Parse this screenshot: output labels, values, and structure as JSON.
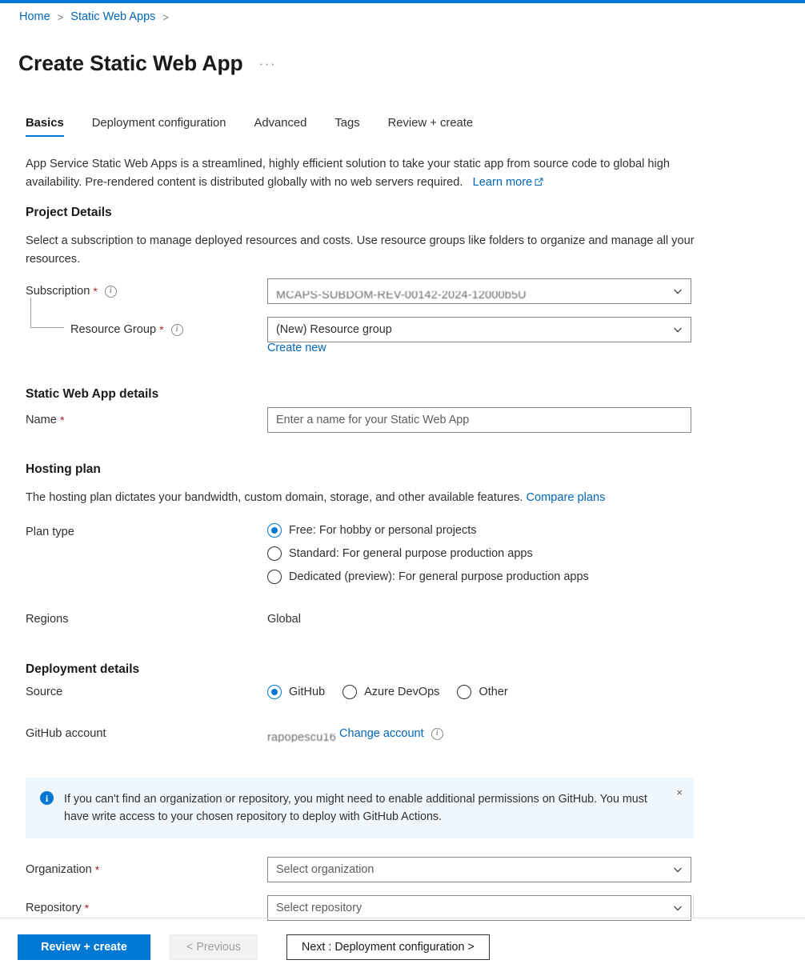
{
  "accent": "#0078d4",
  "link_color": "#0066bb",
  "required_color": "#a4262c",
  "breadcrumb": {
    "items": [
      {
        "label": "Home",
        "sep": ">"
      },
      {
        "label": "Static Web Apps",
        "sep": ">"
      }
    ]
  },
  "header": {
    "title": "Create Static Web App",
    "more_menu": "···"
  },
  "tabs": [
    {
      "label": "Basics",
      "active": true
    },
    {
      "label": "Deployment configuration",
      "active": false
    },
    {
      "label": "Advanced",
      "active": false
    },
    {
      "label": "Tags",
      "active": false
    },
    {
      "label": "Review + create",
      "active": false
    }
  ],
  "intro": {
    "text": "App Service Static Web Apps is a streamlined, highly efficient solution to take your static app from source code to global high availability. Pre-rendered content is distributed globally with no web servers required.",
    "learn_more": "Learn more"
  },
  "project_details": {
    "heading": "Project Details",
    "description": "Select a subscription to manage deployed resources and costs. Use resource groups like folders to organize and manage all your resources.",
    "subscription": {
      "label": "Subscription",
      "required": "*",
      "value": "MCAPS-SUBDOM-REV-00142-2024-12000b5U"
    },
    "resource_group": {
      "label": "Resource Group",
      "required": "*",
      "value": "(New) Resource group",
      "create_new": "Create new"
    }
  },
  "app_details": {
    "heading": "Static Web App details",
    "name": {
      "label": "Name",
      "required": "*",
      "value": "",
      "placeholder": "Enter a name for your Static Web App"
    }
  },
  "hosting_plan": {
    "heading": "Hosting plan",
    "description": "The hosting plan dictates your bandwidth, custom domain, storage, and other available features.",
    "compare_plans": "Compare plans",
    "plan_type_label": "Plan type",
    "options": [
      {
        "label": "Free: For hobby or personal projects",
        "checked": true
      },
      {
        "label": "Standard: For general purpose production apps",
        "checked": false
      },
      {
        "label": "Dedicated (preview): For general purpose production apps",
        "checked": false
      }
    ],
    "regions_label": "Regions",
    "regions_value": "Global"
  },
  "deployment_details": {
    "heading": "Deployment details",
    "source_label": "Source",
    "sources": [
      {
        "label": "GitHub",
        "checked": true
      },
      {
        "label": "Azure DevOps",
        "checked": false
      },
      {
        "label": "Other",
        "checked": false
      }
    ],
    "github_account_label": "GitHub account",
    "github_account_value": "rapopescu16",
    "change_account": "Change account"
  },
  "banner": {
    "icon": "info-icon",
    "text": "If you can't find an organization or repository, you might need to enable additional permissions on GitHub. You must have write access to your chosen repository to deploy with GitHub Actions.",
    "close": "×"
  },
  "github_fields": {
    "organization": {
      "label": "Organization",
      "required": "*",
      "placeholder": "Select organization"
    },
    "repository": {
      "label": "Repository",
      "required": "*",
      "placeholder": "Select repository"
    }
  },
  "footer": {
    "review_create": "Review + create",
    "previous": "< Previous",
    "next": "Next : Deployment configuration >"
  }
}
